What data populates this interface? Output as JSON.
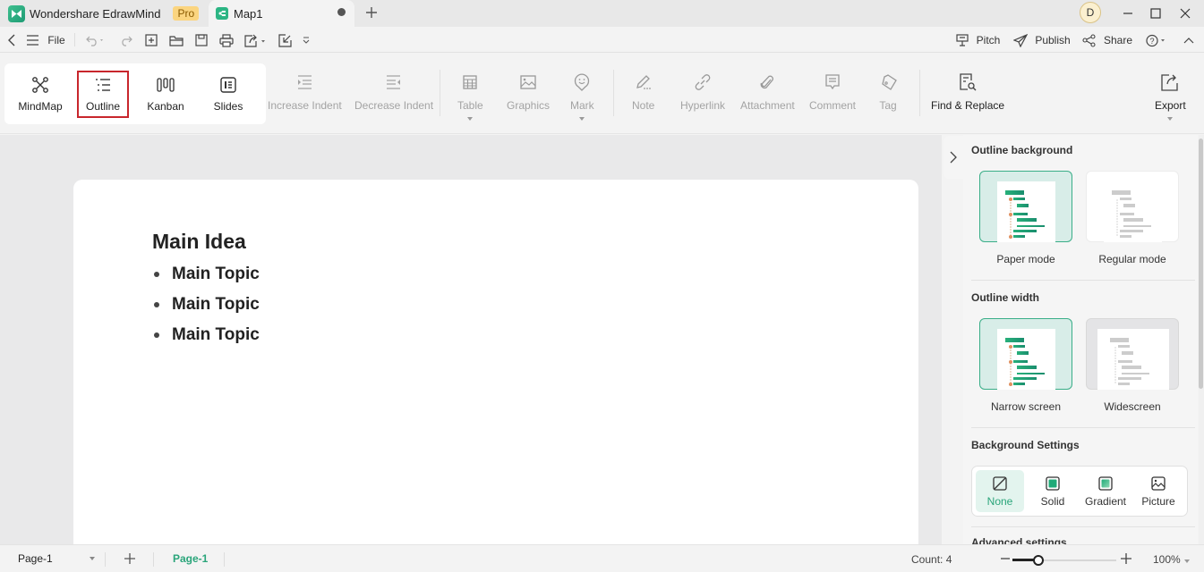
{
  "titlebar": {
    "app_name": "Wondershare EdrawMind",
    "pro_badge": "Pro",
    "document_tab": "Map1",
    "user_initial": "D"
  },
  "quickbar": {
    "file_label": "File",
    "right_actions": [
      {
        "label": "Pitch",
        "icon": "presentation-icon"
      },
      {
        "label": "Publish",
        "icon": "send-icon"
      },
      {
        "label": "Share",
        "icon": "share-icon"
      }
    ]
  },
  "ribbon": {
    "views": [
      {
        "label": "MindMap",
        "icon": "mindmap-icon",
        "active": false
      },
      {
        "label": "Outline",
        "icon": "outline-icon",
        "active": true
      },
      {
        "label": "Kanban",
        "icon": "kanban-icon",
        "active": false
      },
      {
        "label": "Slides",
        "icon": "slides-icon",
        "active": false
      }
    ],
    "tools": {
      "increase_indent": "Increase Indent",
      "decrease_indent": "Decrease Indent",
      "table": "Table",
      "graphics": "Graphics",
      "mark": "Mark",
      "note": "Note",
      "hyperlink": "Hyperlink",
      "attachment": "Attachment",
      "comment": "Comment",
      "tag": "Tag",
      "find_replace": "Find & Replace",
      "export": "Export"
    }
  },
  "outline": {
    "main_idea": "Main Idea",
    "topics": [
      "Main Topic",
      "Main Topic",
      "Main Topic"
    ]
  },
  "panel": {
    "outline_background": {
      "title": "Outline background",
      "options": [
        {
          "label": "Paper mode",
          "selected": true
        },
        {
          "label": "Regular mode",
          "selected": false
        }
      ]
    },
    "outline_width": {
      "title": "Outline width",
      "options": [
        {
          "label": "Narrow screen",
          "selected": true
        },
        {
          "label": "Widescreen",
          "selected": false
        }
      ]
    },
    "background_settings": {
      "title": "Background Settings",
      "options": [
        {
          "label": "None",
          "selected": true
        },
        {
          "label": "Solid",
          "selected": false
        },
        {
          "label": "Gradient",
          "selected": false
        },
        {
          "label": "Picture",
          "selected": false
        }
      ]
    },
    "advanced_settings": "Advanced settings"
  },
  "statusbar": {
    "page_select": "Page-1",
    "page_tab": "Page-1",
    "count": "Count: 4",
    "zoom_level": "100%",
    "zoom_fraction": 0.25
  },
  "colors": {
    "accent": "#2aa57a",
    "active_view_border": "#c8262c",
    "pro_badge_bg": "#fbd580"
  }
}
